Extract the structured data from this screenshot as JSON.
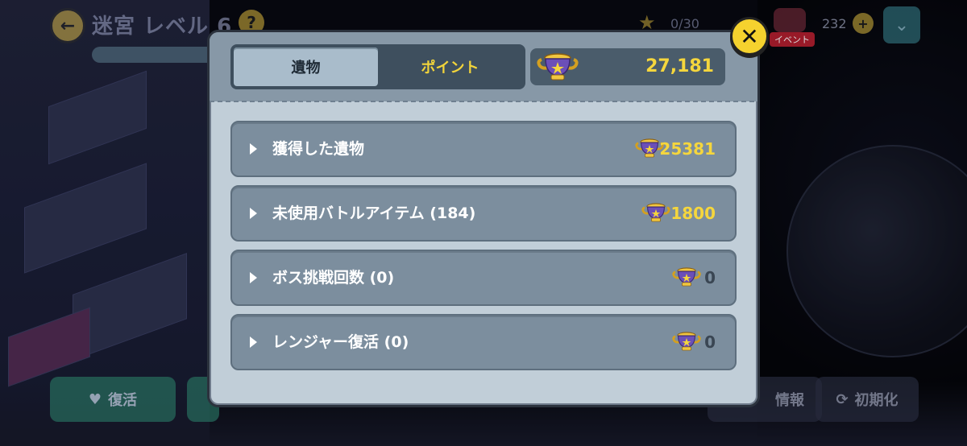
{
  "background": {
    "title": "迷宮 レベル 6",
    "help": "?",
    "stars_count": "0/30",
    "event_badge": "イベント",
    "gems": "232",
    "plus": "+",
    "revive_button": "復活",
    "info_button": "情報",
    "reset_button": "初期化"
  },
  "modal": {
    "tabs": [
      {
        "label": "遺物",
        "active": true
      },
      {
        "label": "ポイント",
        "active": false
      }
    ],
    "points_total": "27,181",
    "close_label": "✕",
    "rows": [
      {
        "label": "獲得した遺物",
        "value": "25381",
        "value_color": "gold"
      },
      {
        "label": "未使用バトルアイテム (184)",
        "value": "1800",
        "value_color": "gold"
      },
      {
        "label": "ボス挑戦回数 (0)",
        "value": "0",
        "value_color": "grey"
      },
      {
        "label": "レンジャー復活 (0)",
        "value": "0",
        "value_color": "grey"
      }
    ]
  },
  "icons": {
    "trophy": "trophy-icon",
    "close": "close-icon",
    "row_arrow": "play-arrow-icon"
  },
  "colors": {
    "gold": "#f5d63d",
    "modal_bg": "#c1ced8",
    "row_bg": "#7c8e9e",
    "close_yellow": "#f5d22e"
  }
}
